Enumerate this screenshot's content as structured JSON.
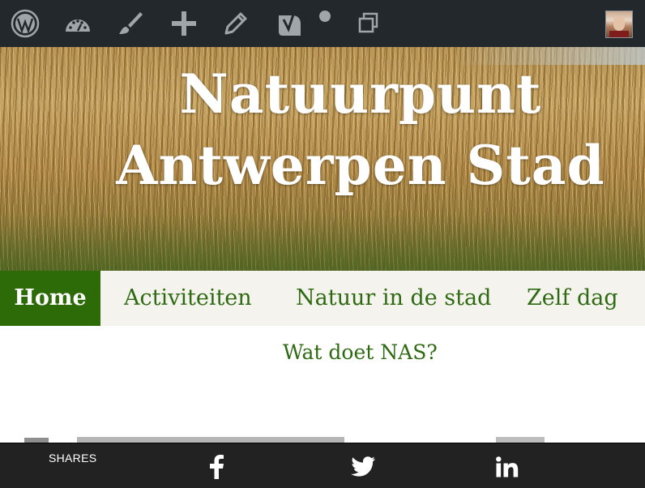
{
  "admin_bar": {
    "items": [
      {
        "icon": "wordpress-logo-icon"
      },
      {
        "icon": "dashboard-icon"
      },
      {
        "icon": "customize-brush-icon"
      },
      {
        "icon": "new-plus-icon"
      },
      {
        "icon": "edit-pencil-icon"
      },
      {
        "icon": "yoast-seo-icon"
      },
      {
        "icon": "status-dot-icon"
      },
      {
        "icon": "duplicate-pages-icon"
      }
    ],
    "avatar": "user-avatar"
  },
  "site": {
    "title_line1": "Natuurpunt",
    "title_line2": "Antwerpen Stad"
  },
  "nav": {
    "items": [
      {
        "label": "Home",
        "active": true
      },
      {
        "label": "Activiteiten"
      },
      {
        "label": "Natuur in de stad"
      },
      {
        "label": "Zelf dag"
      }
    ],
    "sub_item": "Wat doet NAS?"
  },
  "share_bar": {
    "label": "SHARES",
    "buttons": [
      "facebook-icon",
      "twitter-icon",
      "linkedin-icon"
    ]
  },
  "colors": {
    "admin_bar_bg": "#23282d",
    "admin_icon": "#a0a5aa",
    "nav_active_bg": "#2d6a08",
    "nav_text": "#2e6a12",
    "share_bar_bg": "#222222"
  }
}
